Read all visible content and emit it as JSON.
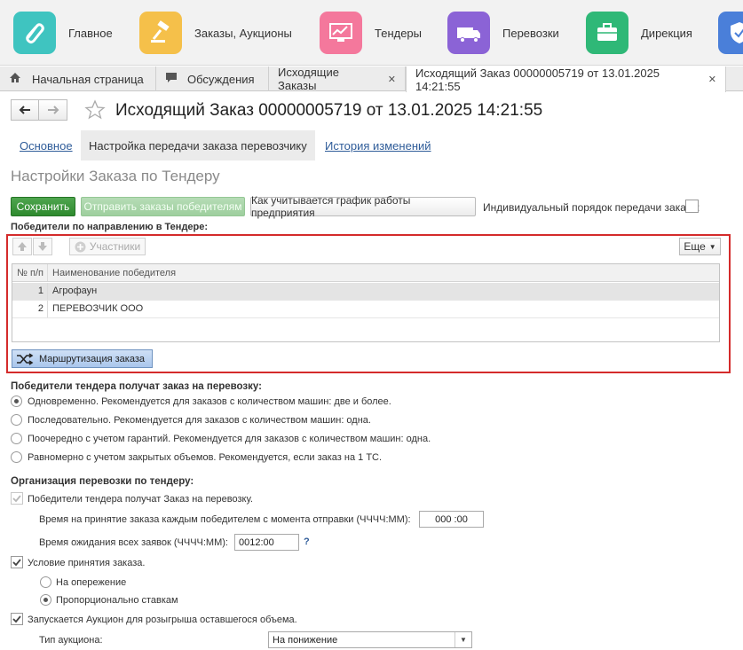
{
  "sections": [
    {
      "label": "Главное",
      "icon": "link-icon",
      "color": "#3fc4c0"
    },
    {
      "label": "Заказы, Аукционы",
      "icon": "gavel-icon",
      "color": "#f5c04a"
    },
    {
      "label": "Тендеры",
      "icon": "chart-monitor-icon",
      "color": "#f4789c"
    },
    {
      "label": "Перевозки",
      "icon": "truck-icon",
      "color": "#8b63d6"
    },
    {
      "label": "Дирекция",
      "icon": "briefcase-icon",
      "color": "#2fb877"
    },
    {
      "label": "",
      "icon": "shield-icon",
      "color": "#4a7fd9"
    }
  ],
  "tabs": [
    {
      "label": "Начальная страница"
    },
    {
      "label": "Обсуждения"
    },
    {
      "label": "Исходящие Заказы"
    },
    {
      "label": "Исходящий Заказ 00000005719 от 13.01.2025 14:21:55"
    }
  ],
  "page": {
    "title": "Исходящий Заказ 00000005719 от 13.01.2025 14:21:55",
    "subtabs": [
      "Основное",
      "Настройка передачи заказа перевозчику",
      "История изменений"
    ],
    "section_title": "Настройки Заказа по Тендеру"
  },
  "toolbar": {
    "save": "Сохранить",
    "send": "Отправить заказы победителям",
    "schedule": "Как учитывается график работы предприятия",
    "individual_label": "Индивидуальный порядок передачи заказа:"
  },
  "winners": {
    "heading": "Победители по направлению в Тендере:",
    "participants": "Участники",
    "more": "Еще",
    "col_num": "№ п/п",
    "col_name": "Наименование победителя",
    "rows": [
      {
        "n": "1",
        "name": "Агрофаун"
      },
      {
        "n": "2",
        "name": "ПЕРЕВОЗЧИК ООО"
      }
    ],
    "routing": "Маршрутизация заказа"
  },
  "delivery": {
    "heading": "Победители тендера получат заказ на перевозку:",
    "options": [
      "Одновременно. Рекомендуется для заказов с количеством машин: две и более.",
      "Последовательно. Рекомендуется для заказов с количеством машин: одна.",
      "Поочередно с учетом гарантий. Рекомендуется для заказов с количеством машин: одна.",
      "Равномерно с учетом закрытых объемов. Рекомендуется, если заказ на 1 ТС."
    ],
    "selected": 0
  },
  "organization": {
    "heading": "Организация перевозки по тендеру:",
    "receive_label": "Победители тендера получат Заказ на перевозку.",
    "accept_time_label": "Время на принятие заказа каждым победителем с момента отправки (ЧЧЧЧ:ММ):",
    "accept_time_value": "000 :00",
    "wait_label": "Время ожидания всех заявок (ЧЧЧЧ:ММ):",
    "wait_value": "0012:00",
    "help": "?",
    "condition_label": "Условие принятия заказа.",
    "condition_options": [
      "На опережение",
      "Пропорционально ставкам"
    ],
    "condition_selected": 1,
    "auction_label": "Запускается Аукцион для розыгрыша оставшегося объема.",
    "auction_type_label": "Тип аукциона:",
    "auction_type_value": "На понижение"
  }
}
